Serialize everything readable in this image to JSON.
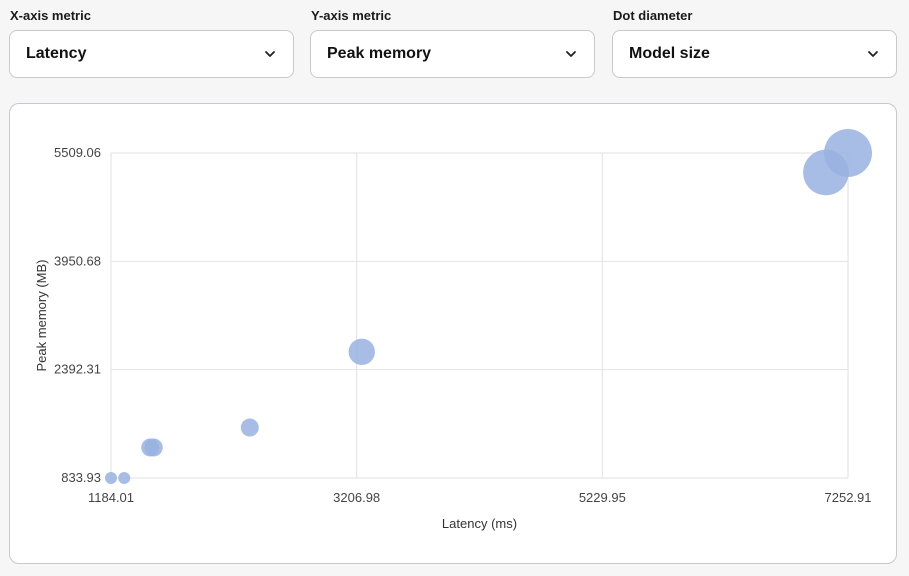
{
  "controls": {
    "x_axis": {
      "label": "X-axis metric",
      "value": "Latency",
      "icon": "chevron-down-icon"
    },
    "y_axis": {
      "label": "Y-axis metric",
      "value": "Peak memory",
      "icon": "chevron-down-icon"
    },
    "diameter": {
      "label": "Dot diameter",
      "value": "Model size",
      "icon": "chevron-down-icon"
    }
  },
  "chart_data": {
    "type": "scatter",
    "title": "",
    "xlabel": "Latency (ms)",
    "ylabel": "Peak memory (MB)",
    "xlim": [
      1184.01,
      7252.91
    ],
    "ylim": [
      833.93,
      5509.06
    ],
    "x_ticks": [
      "1184.01",
      "3206.98",
      "5229.95",
      "7252.91"
    ],
    "y_ticks": [
      "833.93",
      "2392.31",
      "3950.68",
      "5509.06"
    ],
    "grid": true,
    "point_color": "#98b2e0",
    "size_encoding": "Model size",
    "points": [
      {
        "x": 1184.01,
        "y": 833.93,
        "size": 1.0
      },
      {
        "x": 1293.0,
        "y": 833.93,
        "size": 1.0
      },
      {
        "x": 1507.0,
        "y": 1273.0,
        "size": 1.5
      },
      {
        "x": 1536.0,
        "y": 1273.0,
        "size": 1.5
      },
      {
        "x": 2327.0,
        "y": 1560.0,
        "size": 1.5
      },
      {
        "x": 3249.0,
        "y": 2649.0,
        "size": 2.2
      },
      {
        "x": 7071.0,
        "y": 5229.0,
        "size": 3.8
      },
      {
        "x": 7252.91,
        "y": 5509.06,
        "size": 4.0
      }
    ]
  }
}
